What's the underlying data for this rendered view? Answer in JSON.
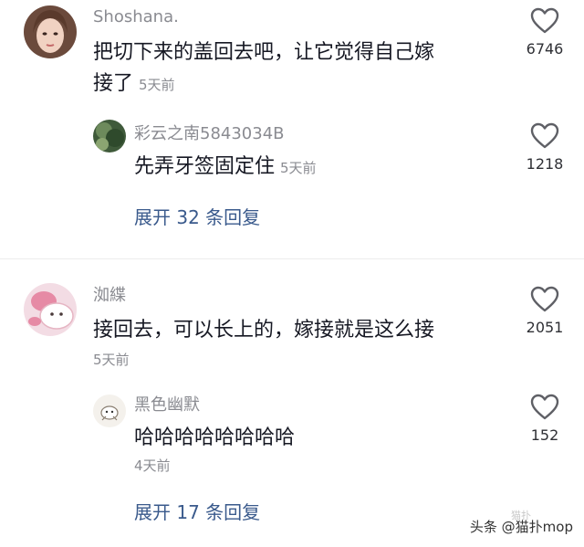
{
  "comments": [
    {
      "username": "Shoshana.",
      "text_line1": "把切下来的盖回去吧，让它觉得自己嫁",
      "text_line2": "接了",
      "time": "5天前",
      "likes": "6746",
      "reply": {
        "username": "彩云之南5843034B",
        "text": "先弄牙签固定住",
        "time": "5天前",
        "likes": "1218"
      },
      "expand_label": "展开 32 条回复"
    },
    {
      "username": "洳緤",
      "text": "接回去，可以长上的，嫁接就是这么接",
      "time": "5天前",
      "likes": "2051",
      "reply": {
        "username": "黑色幽默",
        "text": "哈哈哈哈哈哈哈哈",
        "time": "4天前",
        "likes": "152"
      },
      "expand_label": "展开 17 条回复"
    }
  ],
  "footer": {
    "source": "头条 @猫扑mop",
    "watermark": "猫扑"
  },
  "colors": {
    "username": "#8a8b91",
    "text": "#161823",
    "expand": "#3a5a8c"
  }
}
